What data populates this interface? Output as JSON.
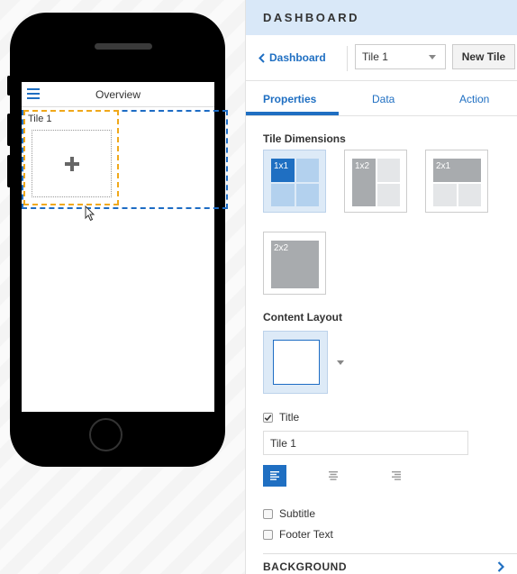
{
  "preview": {
    "app_title": "Overview",
    "tile_label": "Tile 1"
  },
  "panel": {
    "title": "DASHBOARD",
    "back_label": "Dashboard",
    "tile_select_value": "Tile 1",
    "new_tile_label": "New Tile",
    "tabs": [
      {
        "label": "Properties",
        "active": true
      },
      {
        "label": "Data",
        "active": false
      },
      {
        "label": "Action",
        "active": false
      }
    ],
    "tile_dimensions": {
      "heading": "Tile Dimensions",
      "options": [
        {
          "label": "1x1",
          "selected": true
        },
        {
          "label": "1x2",
          "selected": false
        },
        {
          "label": "2x1",
          "selected": false
        },
        {
          "label": "2x2",
          "selected": false
        }
      ]
    },
    "content_layout": {
      "heading": "Content Layout"
    },
    "title_option": {
      "label": "Title",
      "checked": true,
      "value": "Tile 1"
    },
    "alignment": {
      "selected": "left"
    },
    "subtitle_option": {
      "label": "Subtitle",
      "checked": false
    },
    "footer_option": {
      "label": "Footer Text",
      "checked": false
    },
    "background": {
      "label": "BACKGROUND"
    }
  },
  "colors": {
    "accent": "#1f6fc2",
    "header_bg": "#d9e8f8",
    "tile_border": "#f0a81a",
    "area_border": "#1d6cc4"
  }
}
